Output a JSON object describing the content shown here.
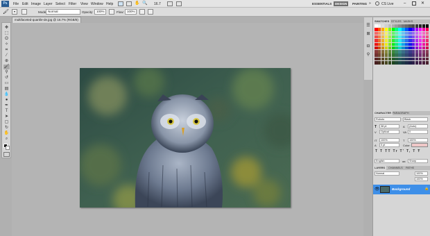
{
  "app": {
    "badge": "Ps"
  },
  "menubar": {
    "items": [
      "File",
      "Edit",
      "Image",
      "Layer",
      "Select",
      "Filter",
      "View",
      "Window",
      "Help"
    ],
    "zoom": "16.7",
    "workspaces": [
      "ESSENTIALS",
      "DESIGN",
      "PAINTING"
    ],
    "active_workspace": "DESIGN",
    "cs_live": "CS Live"
  },
  "options": {
    "mode_label": "Mode:",
    "mode_value": "Normal",
    "opacity_label": "Opacity:",
    "opacity_value": "100%",
    "flow_label": "Flow:",
    "flow_value": "100%"
  },
  "document": {
    "tab_title": "multifaceted-quartile-de.jpg @ 16.7% (RGB/8)"
  },
  "panels": {
    "swatches": {
      "tabs": [
        "SWATCHES",
        "STYLES",
        "MASKS"
      ]
    },
    "character": {
      "tabs": [
        "CHARACTER",
        "PARAGRAPH"
      ],
      "font_family": "Roboto",
      "font_style": "Black",
      "font_size": "38 pt",
      "leading": "(Auto)",
      "tracking": "0",
      "kerning": "Optical",
      "vertical_scale": "100%",
      "horizontal_scale": "100%",
      "baseline": "0 pt",
      "color_label": "Color:",
      "language": "English",
      "antialias": "Sharp"
    },
    "layers": {
      "tabs": [
        "LAYERS",
        "CHANNELS",
        "PATHS"
      ],
      "blend_mode": "Normal",
      "opacity": "100%",
      "fill": "100%",
      "layer_name": "Background"
    }
  }
}
